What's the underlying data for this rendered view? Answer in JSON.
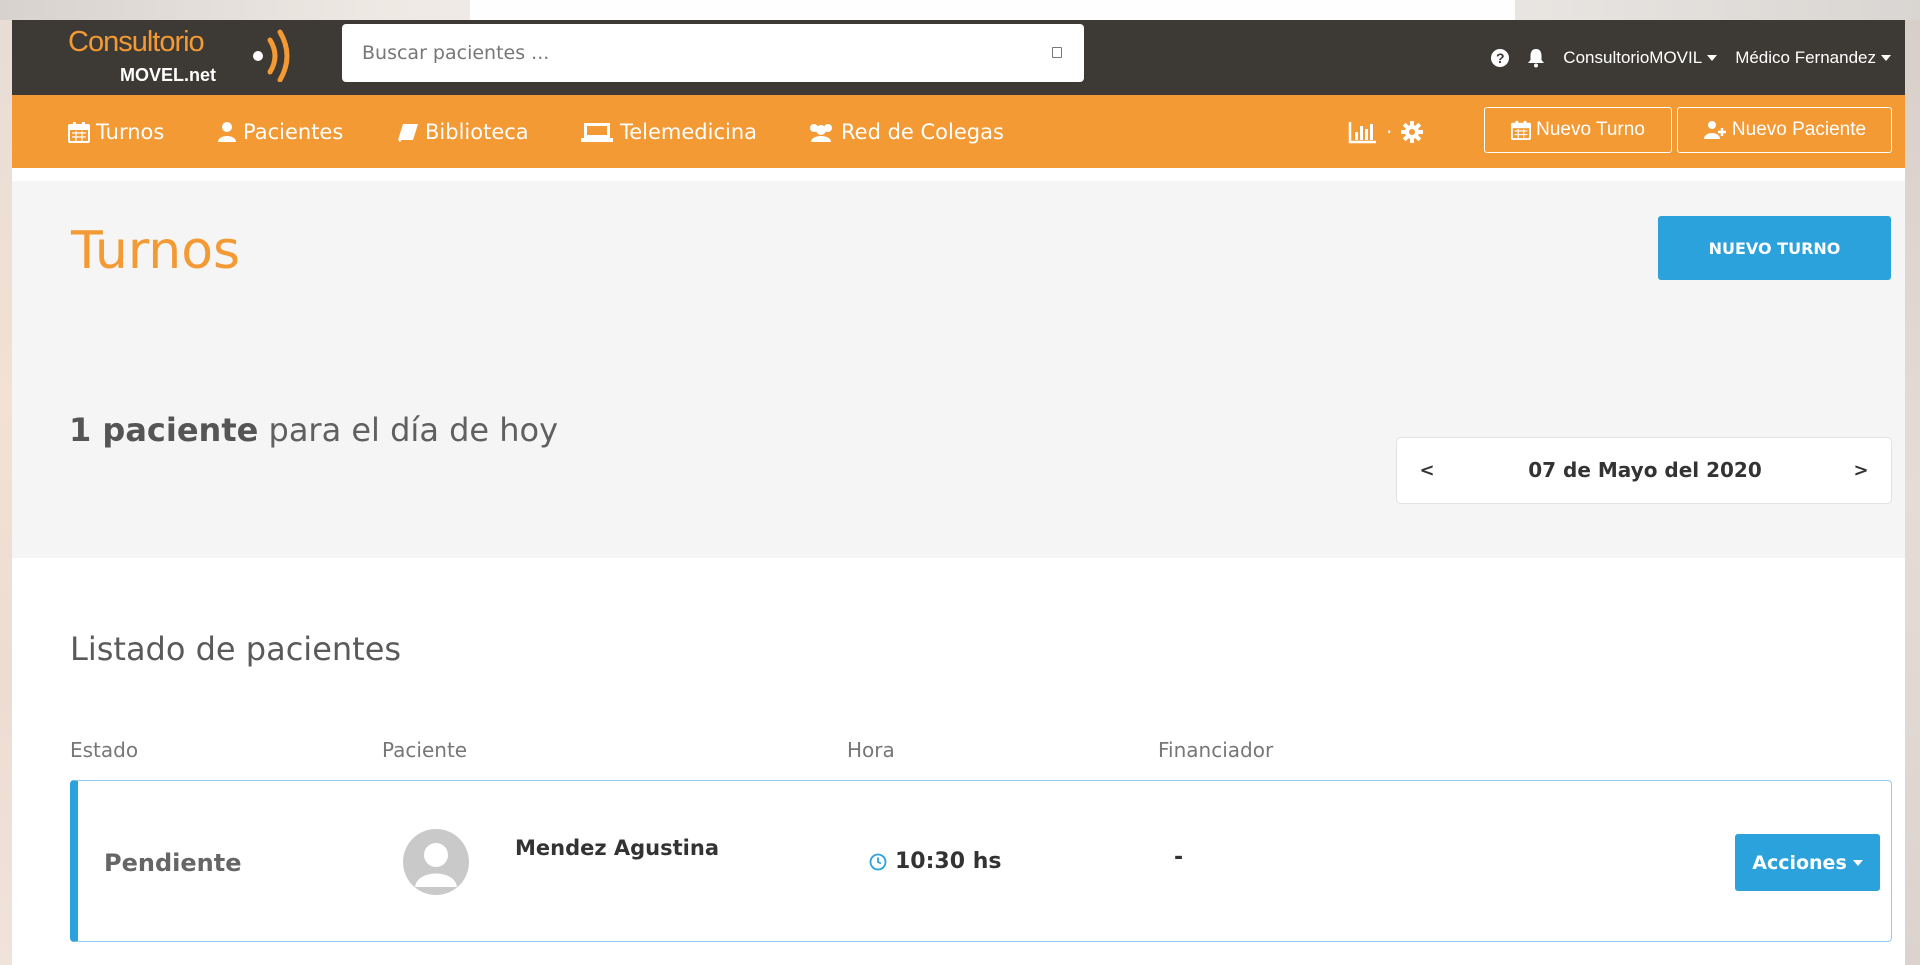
{
  "app": {
    "logo_main": "Consultorio",
    "logo_sub": "MOVEL.net"
  },
  "topbar": {
    "search_placeholder": "Buscar pacientes ...",
    "help_label": "?",
    "account_menu": "ConsultorioMOVIL",
    "user_menu": "Médico Fernandez"
  },
  "nav": {
    "items": [
      {
        "label": "Turnos",
        "icon": "calendar-icon"
      },
      {
        "label": "Pacientes",
        "icon": "user-icon"
      },
      {
        "label": "Biblioteca",
        "icon": "book-icon"
      },
      {
        "label": "Telemedicina",
        "icon": "laptop-icon"
      },
      {
        "label": "Red de Colegas",
        "icon": "users-icon"
      }
    ],
    "tools_separator": "·",
    "btn_nuevo_turno": "Nuevo Turno",
    "btn_nuevo_paciente": "Nuevo Paciente"
  },
  "header": {
    "title": "Turnos",
    "new_button": "NUEVO TURNO",
    "summary_count": "1 paciente",
    "summary_rest": " para el día de hoy",
    "date_prev": "<",
    "date_label": "07 de Mayo del 2020",
    "date_next": ">"
  },
  "list": {
    "title": "Listado de pacientes",
    "columns": [
      "Estado",
      "Paciente",
      "Hora",
      "Financiador"
    ],
    "rows": [
      {
        "estado": "Pendiente",
        "paciente": "Mendez Agustina",
        "hora": "10:30 hs",
        "financiador": "-",
        "action_label": "Acciones"
      }
    ]
  },
  "colors": {
    "topbar": "#3d3934",
    "brand_orange": "#f39a35",
    "accent_blue": "#2ca2dc",
    "header_band": "#f5f5f5"
  }
}
